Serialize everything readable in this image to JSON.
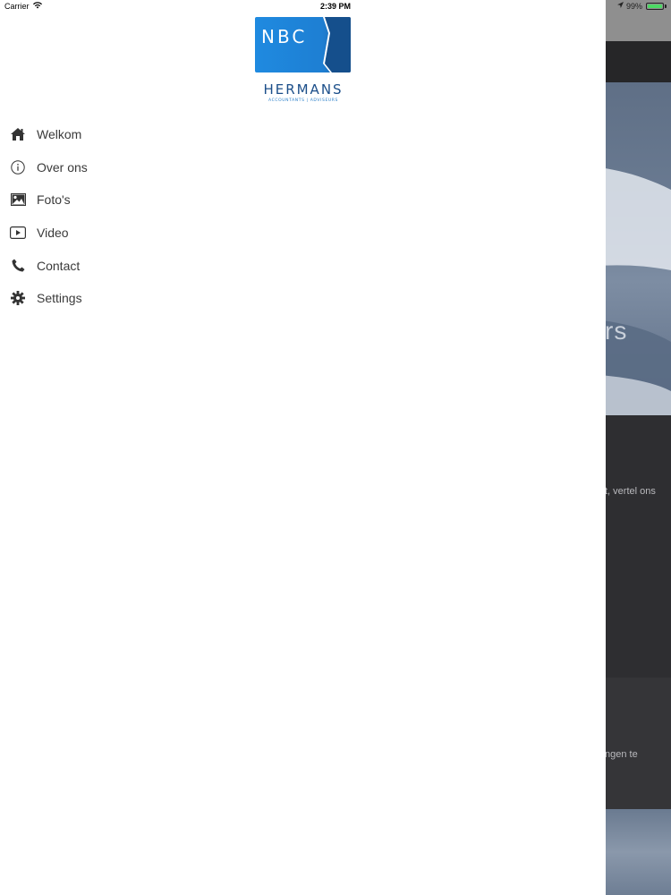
{
  "status_bar": {
    "carrier": "Carrier",
    "time": "2:39 PM",
    "battery": "99%",
    "battery_level": 0.99
  },
  "logo": {
    "letters": "NBC",
    "wordmark": "HERMANS",
    "tagline": "ACCOUNTANTS | ADVISEURS",
    "colors": {
      "box": "#1f8ae0",
      "box_dark": "#1a5c9e",
      "wordmark": "#1c4f8a"
    }
  },
  "menu": {
    "items": [
      {
        "label": "Welkom",
        "icon": "home-icon"
      },
      {
        "label": "Over ons",
        "icon": "info-icon"
      },
      {
        "label": "Foto's",
        "icon": "photo-icon"
      },
      {
        "label": "Video",
        "icon": "video-icon"
      },
      {
        "label": "Contact",
        "icon": "phone-icon"
      },
      {
        "label": "Settings",
        "icon": "gear-icon"
      }
    ]
  },
  "background": {
    "hero_text": "rs",
    "text_1": "t, vertel ons",
    "text_2": "ngen te"
  }
}
